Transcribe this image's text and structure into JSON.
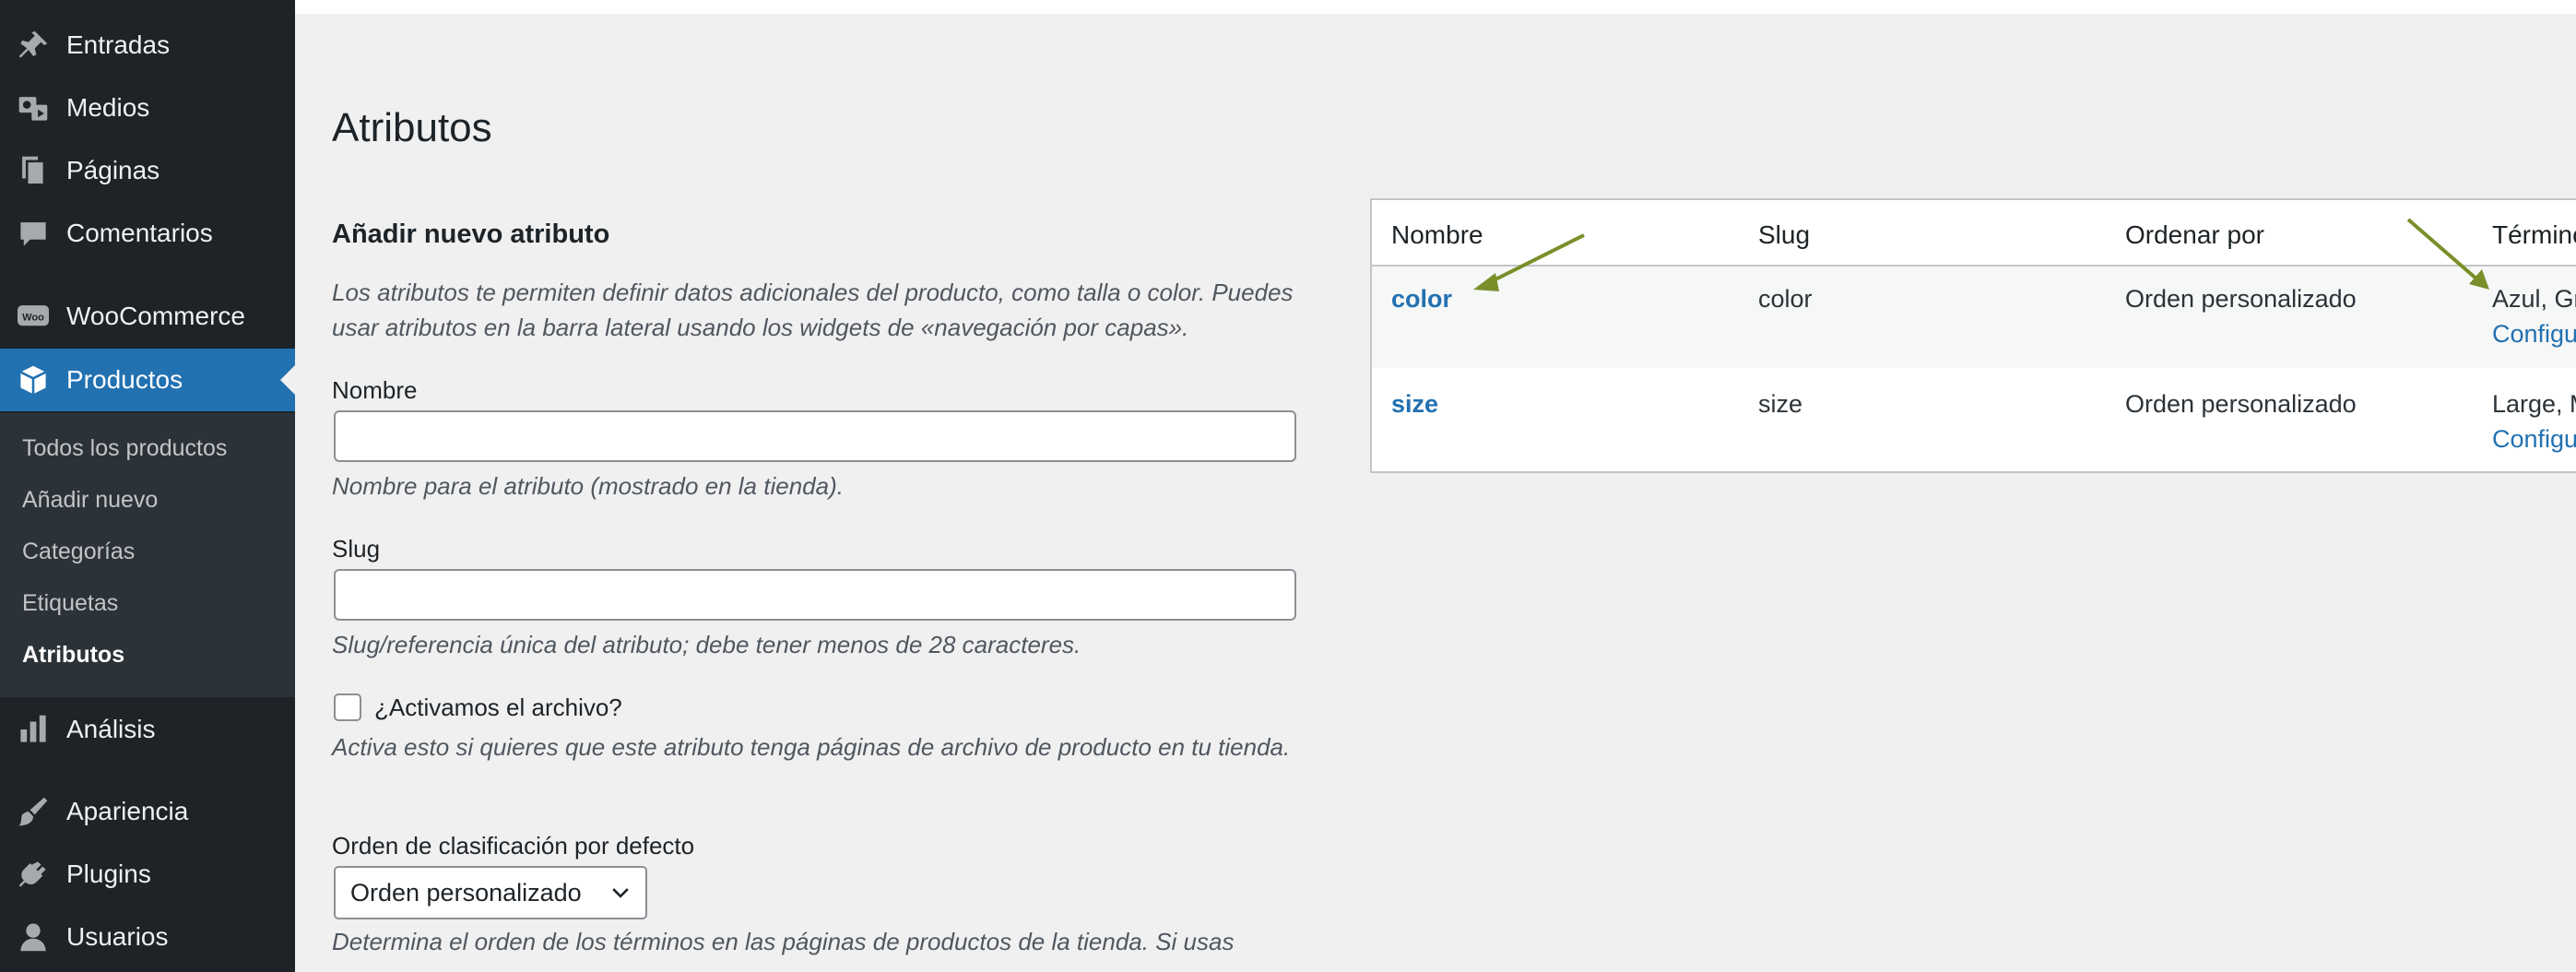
{
  "sidebar": {
    "items": [
      {
        "label": "Entradas",
        "icon": "pin-icon"
      },
      {
        "label": "Medios",
        "icon": "media-icon"
      },
      {
        "label": "Páginas",
        "icon": "pages-icon"
      },
      {
        "label": "Comentarios",
        "icon": "comment-icon"
      },
      {
        "label": "WooCommerce",
        "icon": "woocommerce-icon"
      },
      {
        "label": "Productos",
        "icon": "product-box-icon"
      },
      {
        "label": "Análisis",
        "icon": "bar-chart-icon"
      },
      {
        "label": "Apariencia",
        "icon": "brush-icon"
      },
      {
        "label": "Plugins",
        "icon": "plug-icon"
      },
      {
        "label": "Usuarios",
        "icon": "user-icon"
      }
    ],
    "woo_badge": "Woo",
    "submenu": [
      "Todos los productos",
      "Añadir nuevo",
      "Categorías",
      "Etiquetas",
      "Atributos"
    ]
  },
  "page": {
    "title": "Atributos"
  },
  "form": {
    "heading": "Añadir nuevo atributo",
    "intro": "Los atributos te permiten definir datos adicionales del producto, como talla o color. Puedes usar atributos en la barra lateral usando los widgets de «navegación por capas».",
    "name_label": "Nombre",
    "name_value": "",
    "name_help": "Nombre para el atributo (mostrado en la tienda).",
    "slug_label": "Slug",
    "slug_value": "",
    "slug_help": "Slug/referencia única del atributo; debe tener menos de 28 caracteres.",
    "archive_label": "¿Activamos el archivo?",
    "archive_checked": false,
    "archive_help": "Activa esto si quieres que este atributo tenga páginas de archivo de producto en tu tienda.",
    "order_label": "Orden de clasificación por defecto",
    "order_value": "Orden personalizado",
    "order_help": "Determina el orden de los términos en las páginas de productos de la tienda. Si usas"
  },
  "table": {
    "headers": [
      "Nombre",
      "Slug",
      "Ordenar por",
      "Términos"
    ],
    "rows": [
      {
        "name": "color",
        "slug": "color",
        "order": "Orden personalizado",
        "terms": "Azul, Gris",
        "configure": "Configurar términos"
      },
      {
        "name": "size",
        "slug": "size",
        "order": "Orden personalizado",
        "terms": "Large, Medium",
        "configure": "Configurar términos"
      }
    ]
  },
  "colors": {
    "sidebar_bg": "#1d2327",
    "accent": "#2271b1",
    "annotation_arrow": "#7a8f2a"
  }
}
